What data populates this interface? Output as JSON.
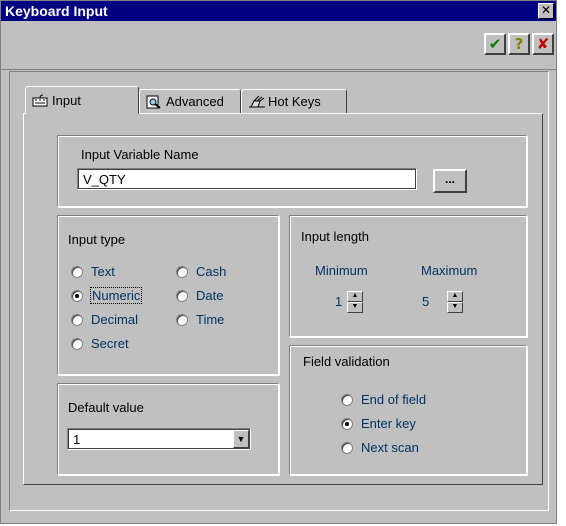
{
  "window": {
    "title": "Keyboard Input",
    "close_glyph": "✕"
  },
  "toolbar": {
    "ok_icon": "check-icon",
    "help_icon": "question-icon",
    "cancel_icon": "x-icon",
    "ok_glyph": "✔",
    "help_glyph": "?",
    "cancel_glyph": "✘"
  },
  "tabs": [
    {
      "label": "Input",
      "icon": "keyboard-icon",
      "active": true
    },
    {
      "label": "Advanced",
      "icon": "magnifier-icon",
      "active": false
    },
    {
      "label": "Hot Keys",
      "icon": "hand-key-icon",
      "active": false
    }
  ],
  "input_variable": {
    "label": "Input Variable Name",
    "value": "V_QTY",
    "browse_label": "..."
  },
  "input_type": {
    "label": "Input type",
    "options": [
      "Text",
      "Numeric",
      "Decimal",
      "Secret",
      "Cash",
      "Date",
      "Time"
    ],
    "selected": "Numeric"
  },
  "input_length": {
    "label": "Input length",
    "minimum_label": "Minimum",
    "minimum_value": "1",
    "maximum_label": "Maximum",
    "maximum_value": "5"
  },
  "default_value": {
    "label": "Default value",
    "value": "1"
  },
  "field_validation": {
    "label": "Field validation",
    "options": [
      "End of field",
      "Enter key",
      "Next scan"
    ],
    "selected": "Enter key"
  },
  "colors": {
    "title_bar": "#000080",
    "face": "#c0c0c0",
    "option_text": "#003366"
  }
}
